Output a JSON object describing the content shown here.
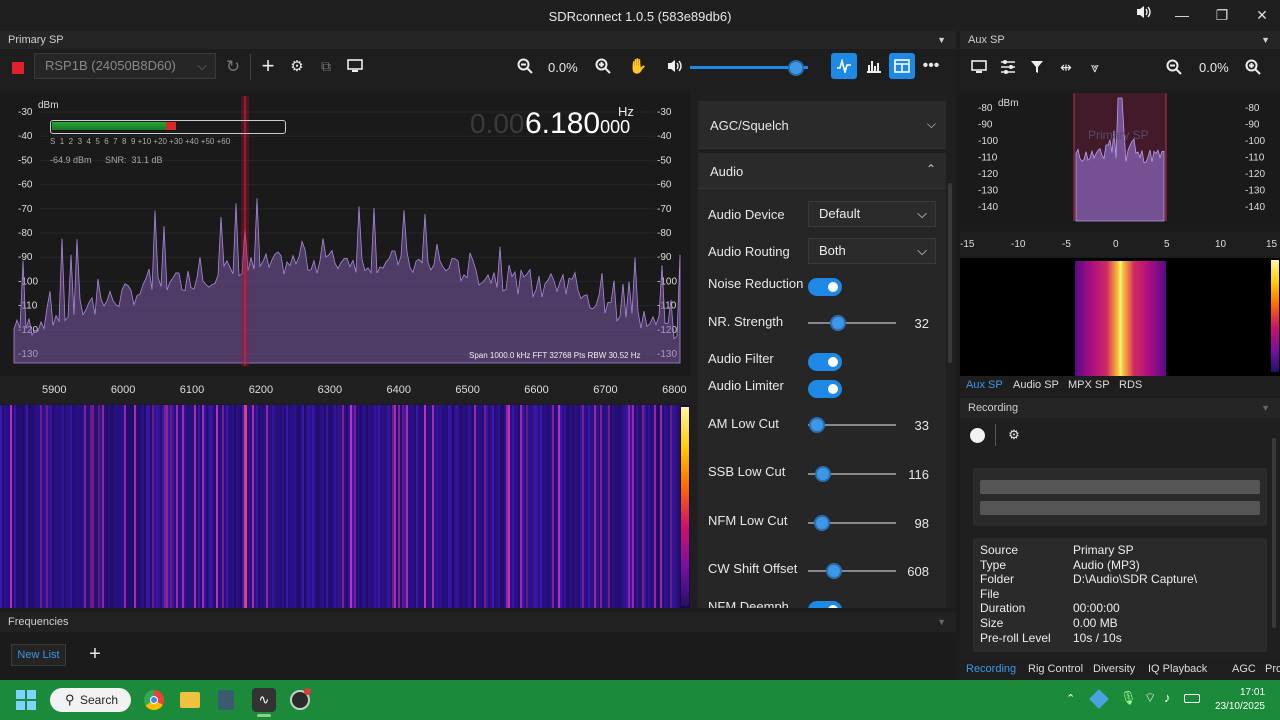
{
  "window": {
    "title": "SDRconnect 1.0.5 (583e89db6)"
  },
  "primary": {
    "panel_title": "Primary SP",
    "device": "RSP1B (24050B8D60)",
    "zoom": "0.0%",
    "volume_pct": 0.9,
    "freq_dim": "0.00",
    "freq_main": "6.180",
    "freq_small": "000",
    "freq_unit": "Hz",
    "signal_dbm": "-64.9 dBm",
    "snr": "SNR:  31.1 dB",
    "smeter_scale": "S  1  2  3  4  5  6  7  8  9 +10 +20 +30 +40 +50 +60",
    "dbm_label": "dBm",
    "yaxis": [
      "-30",
      "-40",
      "-50",
      "-60",
      "-70",
      "-80",
      "-90",
      "-100",
      "-110",
      "-120",
      "-130"
    ],
    "xaxis": [
      "5900",
      "6000",
      "6100",
      "6200",
      "6300",
      "6400",
      "6500",
      "6600",
      "6700",
      "6800"
    ],
    "span_info": "Span 1000.0 kHz FFT 32768 Pts  RBW 30.52 Hz"
  },
  "settings": {
    "agc_title": "AGC/Squelch",
    "audio_title": "Audio",
    "audio_device_label": "Audio Device",
    "audio_device_value": "Default",
    "audio_routing_label": "Audio Routing",
    "audio_routing_value": "Both",
    "noise_reduction_label": "Noise Reduction",
    "nr_strength_label": "NR. Strength",
    "nr_strength_value": "32",
    "audio_filter_label": "Audio Filter",
    "audio_limiter_label": "Audio Limiter",
    "am_low_cut_label": "AM Low Cut",
    "am_low_cut_value": "33",
    "ssb_low_cut_label": "SSB Low Cut",
    "ssb_low_cut_value": "116",
    "nfm_low_cut_label": "NFM Low Cut",
    "nfm_low_cut_value": "98",
    "cw_shift_label": "CW Shift Offset",
    "cw_shift_value": "608",
    "nfm_deemph_label": "NFM Deemph"
  },
  "frequencies": {
    "title": "Frequencies",
    "new_list": "New List"
  },
  "aux": {
    "panel_title": "Aux SP",
    "zoom": "0.0%",
    "dbm_label": "dBm",
    "watermark": "Primary SP",
    "yaxis": [
      "-80",
      "-90",
      "-100",
      "-110",
      "-120",
      "-130",
      "-140"
    ],
    "xaxis": [
      "-15",
      "-10",
      "-5",
      "0",
      "5",
      "10",
      "15"
    ],
    "tabs": [
      "Aux SP",
      "Audio SP",
      "MPX SP",
      "RDS"
    ]
  },
  "recording": {
    "title": "Recording",
    "rows": [
      {
        "k": "Source",
        "v": "Primary SP"
      },
      {
        "k": "Type",
        "v": "Audio (MP3)"
      },
      {
        "k": "Folder",
        "v": "D:\\Audio\\SDR Capture\\"
      },
      {
        "k": "File",
        "v": ""
      },
      {
        "k": "Duration",
        "v": "00:00:00"
      },
      {
        "k": "Size",
        "v": "0.00 MB"
      },
      {
        "k": "Pre-roll Level",
        "v": "10s / 10s"
      }
    ],
    "tabs": [
      "Recording",
      "Rig Control",
      "Diversity",
      "IQ Playback",
      "AGC",
      "Profile"
    ]
  },
  "taskbar": {
    "search": "Search",
    "time": "17:01",
    "date": "23/10/2025"
  },
  "colors": {
    "accent": "#1e88e5",
    "taskbar": "#1b8a3a",
    "spectrum_fill": "#7a5aa8"
  }
}
